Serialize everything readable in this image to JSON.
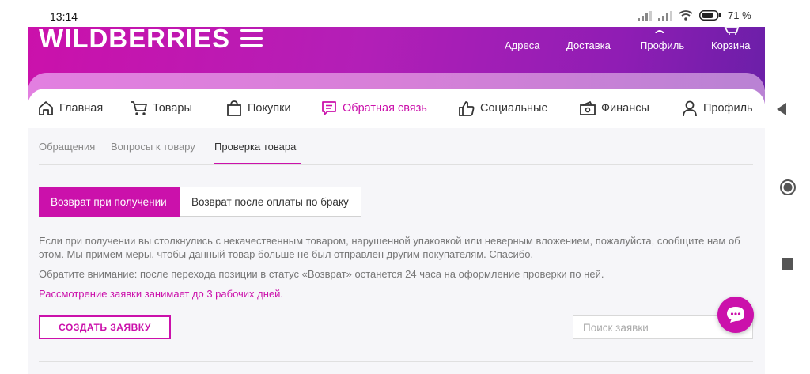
{
  "status_bar": {
    "time": "13:14",
    "battery": "71 %"
  },
  "header": {
    "logo": "WILDBERRIES",
    "nav": [
      {
        "label": "Адреса",
        "icon": "location-icon"
      },
      {
        "label": "Доставка",
        "icon": "delivery-icon"
      },
      {
        "label": "Профиль",
        "icon": "profile-icon"
      },
      {
        "label": "Корзина",
        "icon": "cart-icon"
      }
    ]
  },
  "main_nav": [
    {
      "label": "Главная",
      "icon": "home-icon"
    },
    {
      "label": "Товары",
      "icon": "cart-icon"
    },
    {
      "label": "Покупки",
      "icon": "shopping-bag-icon"
    },
    {
      "label": "Обратная связь",
      "icon": "feedback-icon",
      "active": true
    },
    {
      "label": "Социальные",
      "icon": "thumbs-up-icon"
    },
    {
      "label": "Финансы",
      "icon": "wallet-icon"
    },
    {
      "label": "Профиль",
      "icon": "person-icon"
    }
  ],
  "subtabs": [
    {
      "label": "Обращения"
    },
    {
      "label": "Вопросы к товару"
    },
    {
      "label": "Проверка товара",
      "active": true
    }
  ],
  "segments": [
    {
      "label": "Возврат при получении",
      "active": true
    },
    {
      "label": "Возврат после оплаты по браку"
    }
  ],
  "text": {
    "p1": "Если при получении вы столкнулись с некачественным товаром, нарушенной упаковкой или неверным вложением, пожалуйста, сообщите нам об этом. Мы примем меры, чтобы данный товар больше не был отправлен другим покупателям. Спасибо.",
    "p2": "Обратите внимание: после перехода позиции в статус «Возврат» останется 24 часа на оформление проверки по ней.",
    "p3": "Рассмотрение заявки занимает до 3 рабочих дней."
  },
  "create_button": "СОЗДАТЬ ЗАЯВКУ",
  "search": {
    "placeholder": "Поиск заявки",
    "value": ""
  },
  "colors": {
    "accent": "#cb11ab",
    "header_end": "#6b1fa8"
  }
}
